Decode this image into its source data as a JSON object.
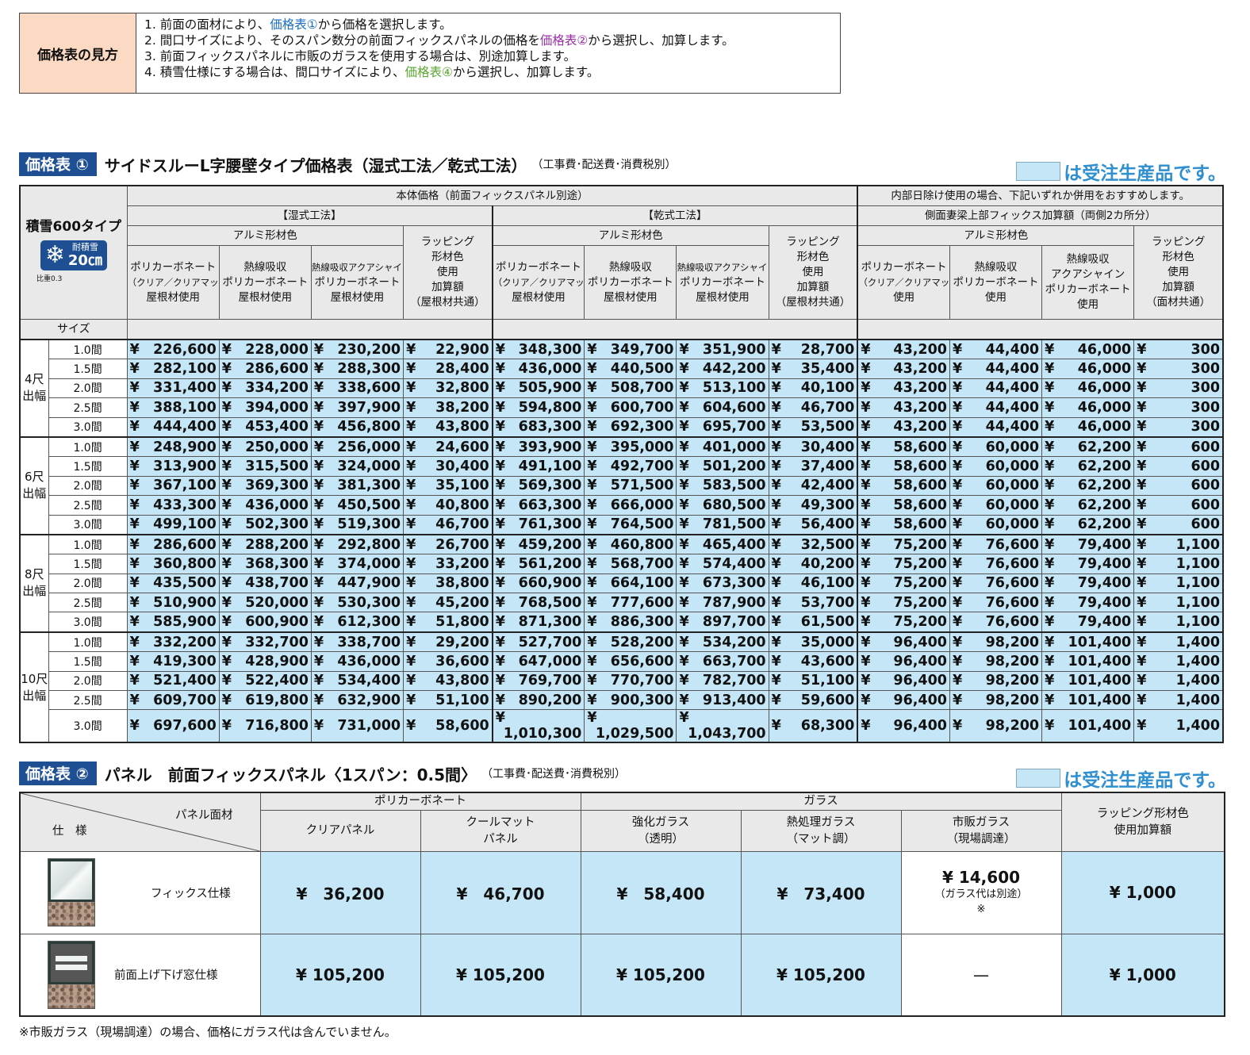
{
  "guide": {
    "label": "価格表の見方",
    "line1": {
      "pre": "1. 前面の面材により、",
      "link": "価格表①",
      "post": "から価格を選択します。"
    },
    "line2": {
      "pre": "2. 間口サイズにより、そのスパン数分の前面フィックスパネルの価格を",
      "link": "価格表②",
      "post": "から選択し、加算します。"
    },
    "line3": {
      "text": "3. 前面フィックスパネルに市販のガラスを使用する場合は、別途加算します。"
    },
    "line4": {
      "pre": "4. 積雪仕様にする場合は、間口サイズにより、",
      "link": "価格表④",
      "post": "から選択し、加算します。"
    }
  },
  "legend_text": "は受注生産品です。",
  "table1": {
    "badge": "価格表 ①",
    "title": "サイドスルーL字腰壁タイプ価格表（湿式工法／乾式工法）",
    "note": "（工事費･配送費･消費税別）",
    "corner_title": "積雪600タイプ",
    "snow_label_top": "耐積雪",
    "snow_label_value": "20㎝",
    "snow_ratio": "比重0.3",
    "size_label": "サイズ",
    "header_main": "本体価格（前面フィックスパネル別途）",
    "header_wet": "【湿式工法】",
    "header_dry": "【乾式工法】",
    "header_side": "内部日除け使用の場合、下記いずれか併用をおすすめします。",
    "header_side_sub": "側面妻梁上部フィックス加算額（両側2カ所分）",
    "header_alumi": "アルミ形材色",
    "header_wrap": "ラッピング形材色使用加算額",
    "col_poly": {
      "a": "ポリカーボネート",
      "b": "（クリア／クリアマット）",
      "c": "屋根材使用"
    },
    "col_heat": {
      "a": "熱線吸収",
      "b": "ポリカーボネート",
      "c": "屋根材使用"
    },
    "col_aqua": {
      "a": "熱線吸収アクアシャイン",
      "b": "ポリカーボネート",
      "c": "屋根材使用"
    },
    "col_wrap_main": {
      "a": "ラッピング",
      "b": "形材色",
      "c": "使用",
      "d": "加算額",
      "e": "（屋根材共通）"
    },
    "col_side_poly": {
      "a": "ポリカーボネート",
      "b": "（クリア／クリアマット）",
      "c": "使用"
    },
    "col_side_heat": {
      "a": "熱線吸収",
      "b": "ポリカーボネート",
      "c": "使用"
    },
    "col_side_aqua": {
      "a": "熱線吸収",
      "b": "アクアシャイン",
      "c": "ポリカーボネート",
      "d": "使用"
    },
    "col_side_wrap": {
      "a": "ラッピング",
      "b": "形材色",
      "c": "使用",
      "d": "加算額",
      "e": "（面材共通）"
    },
    "yen": "¥",
    "groups": [
      {
        "label": "4尺出幅",
        "rows": [
          {
            "size": "1.0間",
            "vals": [
              "226,600",
              "228,000",
              "230,200",
              "22,900",
              "348,300",
              "349,700",
              "351,900",
              "28,700",
              "43,200",
              "44,400",
              "46,000",
              "300"
            ]
          },
          {
            "size": "1.5間",
            "vals": [
              "282,100",
              "286,600",
              "288,300",
              "28,400",
              "436,000",
              "440,500",
              "442,200",
              "35,400",
              "43,200",
              "44,400",
              "46,000",
              "300"
            ]
          },
          {
            "size": "2.0間",
            "vals": [
              "331,400",
              "334,200",
              "338,600",
              "32,800",
              "505,900",
              "508,700",
              "513,100",
              "40,100",
              "43,200",
              "44,400",
              "46,000",
              "300"
            ]
          },
          {
            "size": "2.5間",
            "vals": [
              "388,100",
              "394,000",
              "397,900",
              "38,200",
              "594,800",
              "600,700",
              "604,600",
              "46,700",
              "43,200",
              "44,400",
              "46,000",
              "300"
            ]
          },
          {
            "size": "3.0間",
            "vals": [
              "444,400",
              "453,400",
              "456,800",
              "43,800",
              "683,300",
              "692,300",
              "695,700",
              "53,500",
              "43,200",
              "44,400",
              "46,000",
              "300"
            ]
          }
        ]
      },
      {
        "label": "6尺出幅",
        "rows": [
          {
            "size": "1.0間",
            "vals": [
              "248,900",
              "250,000",
              "256,000",
              "24,600",
              "393,900",
              "395,000",
              "401,000",
              "30,400",
              "58,600",
              "60,000",
              "62,200",
              "600"
            ]
          },
          {
            "size": "1.5間",
            "vals": [
              "313,900",
              "315,500",
              "324,000",
              "30,400",
              "491,100",
              "492,700",
              "501,200",
              "37,400",
              "58,600",
              "60,000",
              "62,200",
              "600"
            ]
          },
          {
            "size": "2.0間",
            "vals": [
              "367,100",
              "369,300",
              "381,300",
              "35,100",
              "569,300",
              "571,500",
              "583,500",
              "42,400",
              "58,600",
              "60,000",
              "62,200",
              "600"
            ]
          },
          {
            "size": "2.5間",
            "vals": [
              "433,300",
              "436,000",
              "450,500",
              "40,800",
              "663,300",
              "666,000",
              "680,500",
              "49,300",
              "58,600",
              "60,000",
              "62,200",
              "600"
            ]
          },
          {
            "size": "3.0間",
            "vals": [
              "499,100",
              "502,300",
              "519,300",
              "46,700",
              "761,300",
              "764,500",
              "781,500",
              "56,400",
              "58,600",
              "60,000",
              "62,200",
              "600"
            ]
          }
        ]
      },
      {
        "label": "8尺出幅",
        "rows": [
          {
            "size": "1.0間",
            "vals": [
              "286,600",
              "288,200",
              "292,800",
              "26,700",
              "459,200",
              "460,800",
              "465,400",
              "32,500",
              "75,200",
              "76,600",
              "79,400",
              "1,100"
            ]
          },
          {
            "size": "1.5間",
            "vals": [
              "360,800",
              "368,300",
              "374,000",
              "33,200",
              "561,200",
              "568,700",
              "574,400",
              "40,200",
              "75,200",
              "76,600",
              "79,400",
              "1,100"
            ]
          },
          {
            "size": "2.0間",
            "vals": [
              "435,500",
              "438,700",
              "447,900",
              "38,800",
              "660,900",
              "664,100",
              "673,300",
              "46,100",
              "75,200",
              "76,600",
              "79,400",
              "1,100"
            ]
          },
          {
            "size": "2.5間",
            "vals": [
              "510,900",
              "520,000",
              "530,300",
              "45,200",
              "768,500",
              "777,600",
              "787,900",
              "53,700",
              "75,200",
              "76,600",
              "79,400",
              "1,100"
            ]
          },
          {
            "size": "3.0間",
            "vals": [
              "585,900",
              "600,900",
              "612,300",
              "51,800",
              "871,300",
              "886,300",
              "897,700",
              "61,500",
              "75,200",
              "76,600",
              "79,400",
              "1,100"
            ]
          }
        ]
      },
      {
        "label": "10尺出幅",
        "rows": [
          {
            "size": "1.0間",
            "vals": [
              "332,200",
              "332,700",
              "338,700",
              "29,200",
              "527,700",
              "528,200",
              "534,200",
              "35,000",
              "96,400",
              "98,200",
              "101,400",
              "1,400"
            ]
          },
          {
            "size": "1.5間",
            "vals": [
              "419,300",
              "428,900",
              "436,000",
              "36,600",
              "647,000",
              "656,600",
              "663,700",
              "43,600",
              "96,400",
              "98,200",
              "101,400",
              "1,400"
            ]
          },
          {
            "size": "2.0間",
            "vals": [
              "521,400",
              "522,400",
              "534,400",
              "43,800",
              "769,700",
              "770,700",
              "782,700",
              "51,100",
              "96,400",
              "98,200",
              "101,400",
              "1,400"
            ]
          },
          {
            "size": "2.5間",
            "vals": [
              "609,700",
              "619,800",
              "632,900",
              "51,100",
              "890,200",
              "900,300",
              "913,400",
              "59,600",
              "96,400",
              "98,200",
              "101,400",
              "1,400"
            ]
          },
          {
            "size": "3.0間",
            "vals": [
              "697,600",
              "716,800",
              "731,000",
              "58,600",
              "1,010,300",
              "1,029,500",
              "1,043,700",
              "68,300",
              "96,400",
              "98,200",
              "101,400",
              "1,400"
            ]
          }
        ]
      }
    ]
  },
  "table2": {
    "badge": "価格表 ②",
    "title": "パネル　前面フィックスパネル〈1スパン：0.5間〉",
    "note": "（工事費･配送費･消費税別）",
    "corner_top": "パネル面材",
    "corner_bottom": "仕　様",
    "group_poly": "ポリカーボネート",
    "group_glass": "ガラス",
    "col_clear": "クリアパネル",
    "col_cool": {
      "a": "クールマット",
      "b": "パネル"
    },
    "col_tempered": {
      "a": "強化ガラス",
      "b": "（透明）"
    },
    "col_heattreated": {
      "a": "熱処理ガラス",
      "b": "（マット調）"
    },
    "col_market": {
      "a": "市販ガラス",
      "b": "（現場調達）"
    },
    "col_wrap": {
      "a": "ラッピング形材色",
      "b": "使用加算額"
    },
    "rows": [
      {
        "spec": "フィックス仕様",
        "vals": [
          "¥　36,200",
          "¥　46,700",
          "¥　58,400",
          "¥　73,400",
          "¥ 14,600",
          "¥ 1,000"
        ],
        "market_note": "（ガラス代は別途）",
        "market_mark": "※"
      },
      {
        "spec": "前面上げ下げ窓仕様",
        "vals": [
          "¥ 105,200",
          "¥ 105,200",
          "¥ 105,200",
          "¥ 105,200",
          "—",
          "¥ 1,000"
        ]
      }
    ]
  },
  "footnote": "※市販ガラス（現場調達）の場合、価格にガラス代は含んでいません。"
}
